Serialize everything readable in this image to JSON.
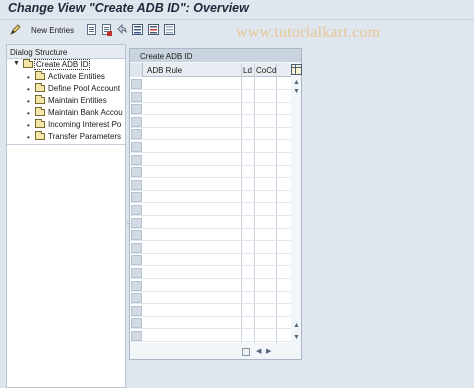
{
  "title": "Change View \"Create ADB ID\": Overview",
  "watermark": "www.tutorialkart.com",
  "toolbar": {
    "new_entries_label": "New Entries",
    "icons": [
      "pen-icon",
      "copy-icon",
      "delete-icon",
      "undo-icon",
      "select-all-icon",
      "select-block-icon",
      "deselect-all-icon"
    ]
  },
  "dialog_structure": {
    "header": "Dialog Structure",
    "items": [
      {
        "label": "Create ADB ID",
        "selected": true,
        "expanded": true
      },
      {
        "label": "Activate Entities"
      },
      {
        "label": "Define Pool Account"
      },
      {
        "label": "Maintain Entities"
      },
      {
        "label": "Maintain Bank Accou"
      },
      {
        "label": "Incoming Interest Po"
      },
      {
        "label": "Transfer Parameters"
      }
    ]
  },
  "table_panel": {
    "title": "Create ADB ID",
    "columns": [
      "ADB Rule",
      "Ld",
      "CoCd"
    ],
    "row_count": 21
  }
}
